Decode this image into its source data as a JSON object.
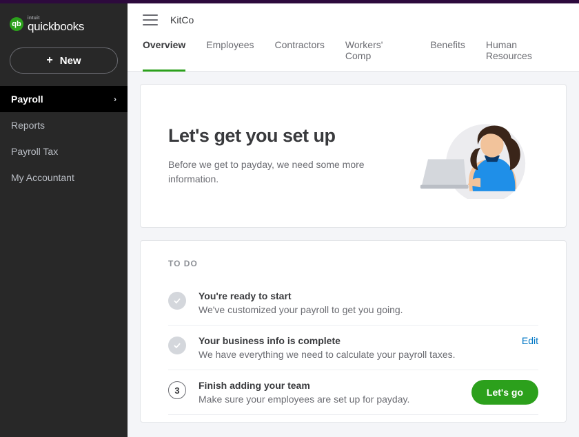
{
  "brand": {
    "sup": "intuit",
    "main": "quickbooks"
  },
  "newButton": "New",
  "companyName": "KitCo",
  "sidebar": {
    "items": [
      {
        "label": "Payroll"
      },
      {
        "label": "Reports"
      },
      {
        "label": "Payroll Tax"
      },
      {
        "label": "My Accountant"
      }
    ]
  },
  "tabs": [
    {
      "label": "Overview"
    },
    {
      "label": "Employees"
    },
    {
      "label": "Contractors"
    },
    {
      "label": "Workers' Comp"
    },
    {
      "label": "Benefits"
    },
    {
      "label": "Human Resources"
    }
  ],
  "hero": {
    "title": "Let's get you set up",
    "subtitle": "Before we get to payday, we need some more information."
  },
  "todoLabel": "TO DO",
  "todo": [
    {
      "title": "You're ready to start",
      "desc": "We've customized your payroll to get you going."
    },
    {
      "title": "Your business info is complete",
      "desc": "We have everything we need to calculate your payroll taxes.",
      "action": "Edit"
    },
    {
      "title": "Finish adding your team",
      "desc": "Make sure your employees are set up for payday.",
      "step": "3",
      "action": "Let's go"
    }
  ]
}
